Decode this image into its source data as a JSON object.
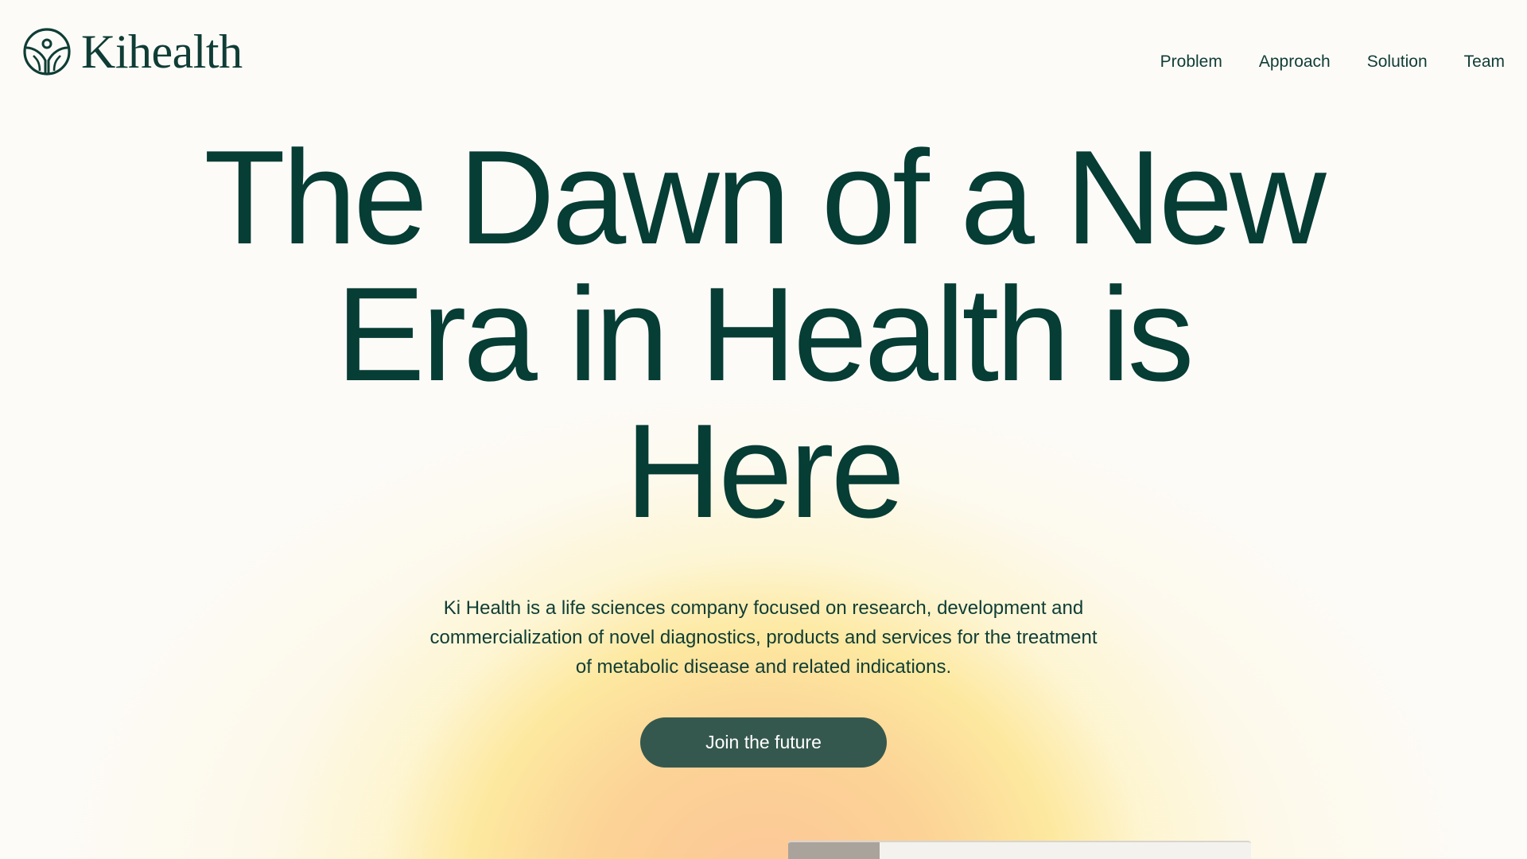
{
  "brand": {
    "name": "Kihealth",
    "icon": "kihealth-logo-icon",
    "color": "#0f3d35"
  },
  "nav": {
    "items": [
      {
        "label": "Problem"
      },
      {
        "label": "Approach"
      },
      {
        "label": "Solution"
      },
      {
        "label": "Team"
      }
    ]
  },
  "hero": {
    "headline_lines": [
      "The Dawn of a New",
      "Era in Health is",
      "Here"
    ],
    "description": "Ki Health is a life sciences company focused on research, development and commercialization of novel diagnostics, products and services for the treatment of metabolic disease and related indications.",
    "cta_label": "Join the future"
  },
  "colors": {
    "background": "#fdfbf8",
    "headline": "#063d34",
    "button": "#35584e",
    "glow_yellow": "#fde48c",
    "glow_peach": "#fcc496"
  }
}
